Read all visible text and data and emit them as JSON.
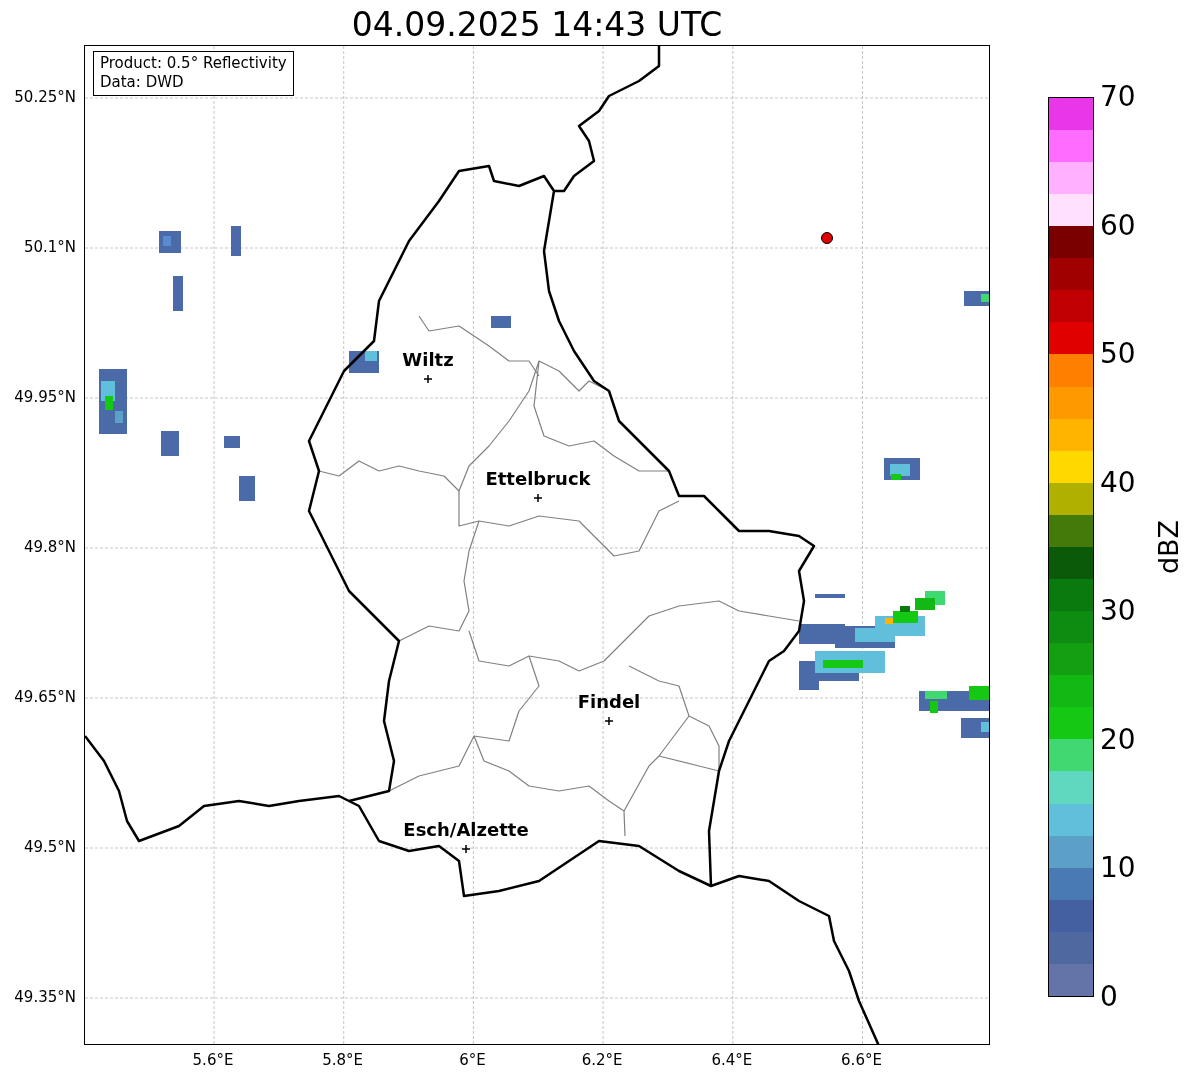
{
  "title": "04.09.2025 14:43 UTC",
  "info_box": {
    "lines": [
      "Product: 0.5° Reflectivity",
      "Data: DWD"
    ]
  },
  "y_ticks": [
    "50.25°N",
    "50.1°N",
    "49.95°N",
    "49.8°N",
    "49.65°N",
    "49.5°N",
    "49.35°N"
  ],
  "x_ticks": [
    "5.6°E",
    "5.8°E",
    "6°E",
    "6.2°E",
    "6.4°E",
    "6.6°E"
  ],
  "cities": [
    {
      "name": "Wiltz"
    },
    {
      "name": "Ettelbruck"
    },
    {
      "name": "Findel"
    },
    {
      "name": "Esch/Alzette"
    }
  ],
  "colorbar": {
    "label": "dBZ",
    "ticks": [
      "70",
      "60",
      "50",
      "40",
      "30",
      "20",
      "10",
      "0"
    ],
    "steps": [
      {
        "color": "#6474a8"
      },
      {
        "color": "#5068a0"
      },
      {
        "color": "#4460a0"
      },
      {
        "color": "#4a7ab4"
      },
      {
        "color": "#5ca0c8"
      },
      {
        "color": "#60c0dc"
      },
      {
        "color": "#60d8c0"
      },
      {
        "color": "#40d870"
      },
      {
        "color": "#14c814"
      },
      {
        "color": "#14b814"
      },
      {
        "color": "#12a012"
      },
      {
        "color": "#0e8c12"
      },
      {
        "color": "#0a7a0e"
      },
      {
        "color": "#0a5a0a"
      },
      {
        "color": "#447a0a"
      },
      {
        "color": "#b0b000"
      },
      {
        "color": "#ffd800"
      },
      {
        "color": "#ffb400"
      },
      {
        "color": "#ff9900"
      },
      {
        "color": "#ff7f00"
      },
      {
        "color": "#e00000"
      },
      {
        "color": "#c00000"
      },
      {
        "color": "#a00000"
      },
      {
        "color": "#7a0000"
      },
      {
        "color": "#ffe0ff"
      },
      {
        "color": "#ffb0ff"
      },
      {
        "color": "#ff6cff"
      },
      {
        "color": "#e836e8"
      }
    ]
  }
}
